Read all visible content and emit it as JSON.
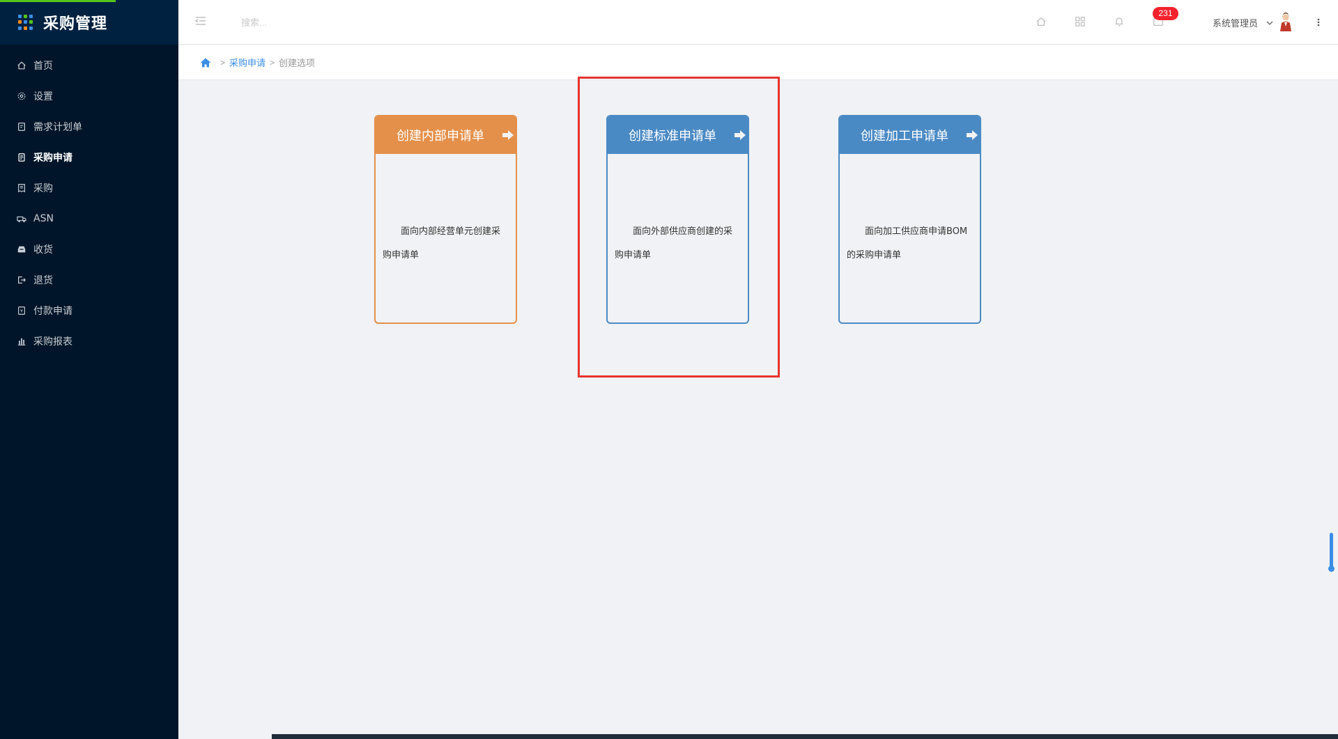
{
  "app": {
    "title": "采购管理"
  },
  "sidebar": {
    "items": [
      {
        "label": "首页",
        "icon": "home-icon",
        "active": false
      },
      {
        "label": "设置",
        "icon": "gear-icon",
        "active": false
      },
      {
        "label": "需求计划单",
        "icon": "document-icon",
        "active": false
      },
      {
        "label": "采购申请",
        "icon": "clipboard-icon",
        "active": true
      },
      {
        "label": "采购",
        "icon": "receipt-icon",
        "active": false
      },
      {
        "label": "ASN",
        "icon": "truck-icon",
        "active": false
      },
      {
        "label": "收货",
        "icon": "inbox-icon",
        "active": false
      },
      {
        "label": "退货",
        "icon": "exit-icon",
        "active": false
      },
      {
        "label": "付款申请",
        "icon": "payment-icon",
        "active": false
      },
      {
        "label": "采购报表",
        "icon": "bar-chart-icon",
        "active": false
      }
    ]
  },
  "header": {
    "search_placeholder": "搜索...",
    "notification_count": "231",
    "user_name": "系统管理员"
  },
  "breadcrumb": {
    "parent": "采购申请",
    "current": "创建选项",
    "separator": ">"
  },
  "cards": [
    {
      "title": "创建内部申请单",
      "desc": "面向内部经营单元创建采购申请单",
      "color": "#e4904a"
    },
    {
      "title": "创建标准申请单",
      "desc": "面向外部供应商创建的采购申请单",
      "color": "#4a8ac4"
    },
    {
      "title": "创建加工申请单",
      "desc": "面向加工供应商申请BOM的采购申请单",
      "color": "#4a8ac4"
    }
  ],
  "colors": {
    "sidebar_bg": "#001529",
    "accent": "#3a8ee6",
    "highlight": "#e8332f",
    "badge": "#f5222d"
  }
}
